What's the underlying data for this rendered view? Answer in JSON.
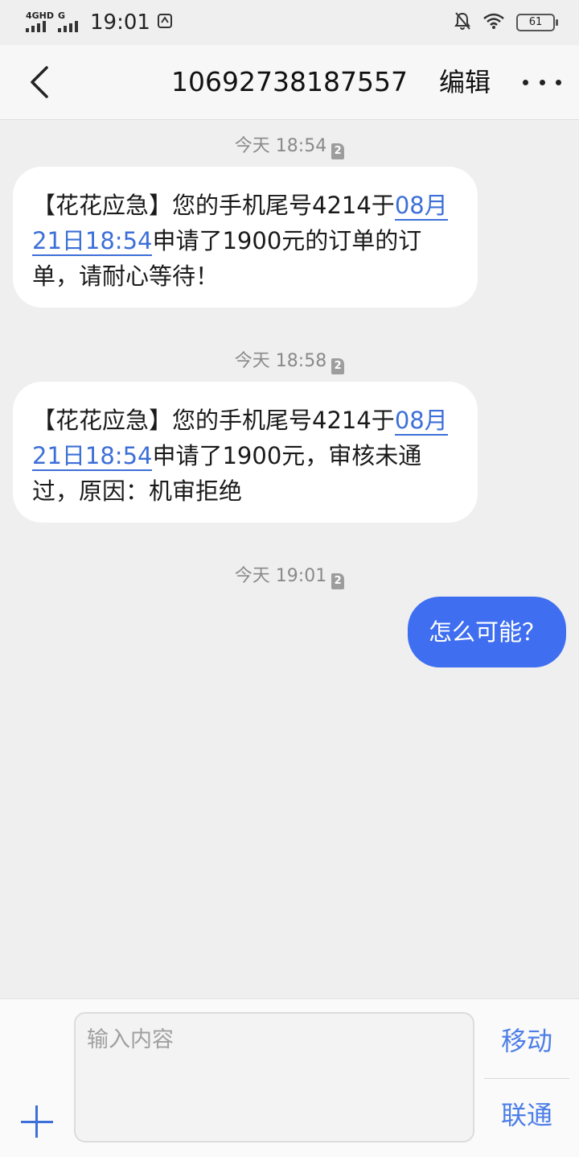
{
  "status_bar": {
    "sim1_label": "4GHD",
    "sim2_label": "G",
    "time": "19:01",
    "battery": "61"
  },
  "header": {
    "title": "10692738187557",
    "edit_label": "编辑"
  },
  "messages": [
    {
      "timestamp": "今天 18:54",
      "sim_badge": "2",
      "direction": "incoming",
      "text_before_link": "【花花应急】您的手机尾号4214于",
      "link_text": "08月21日18:54",
      "text_after_link": "申请了1900元的订单的订单，请耐心等待！"
    },
    {
      "timestamp": "今天 18:58",
      "sim_badge": "2",
      "direction": "incoming",
      "text_before_link": "【花花应急】您的手机尾号4214于",
      "link_text": "08月21日18:54",
      "text_after_link": "申请了1900元，审核未通过，原因：机审拒绝"
    },
    {
      "timestamp": "今天 19:01",
      "sim_badge": "2",
      "direction": "outgoing",
      "text": "怎么可能？"
    }
  ],
  "composer": {
    "placeholder": "输入内容",
    "send_sim1_label": "移动",
    "send_sim2_label": "联通"
  },
  "colors": {
    "accent": "#3f6ff0",
    "link": "#3d6fd8",
    "background": "#efefef"
  }
}
